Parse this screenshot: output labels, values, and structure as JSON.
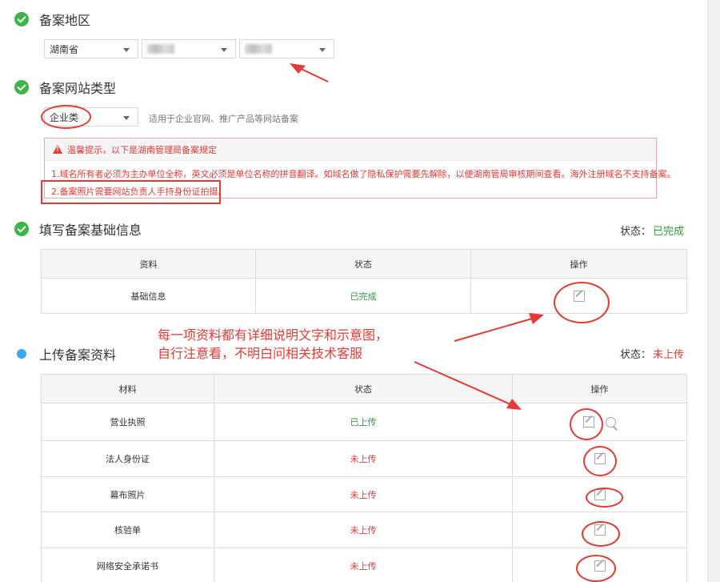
{
  "region": {
    "title": "备案地区",
    "province": "湖南省"
  },
  "site_type": {
    "title": "备案网站类型",
    "selected": "企业类",
    "hint": "适用于企业官网、推广产品等网站备案"
  },
  "tip": {
    "header": "温馨提示，以下是湖南管理局备案规定",
    "line1": "1.域名所有者必须为主办单位全称，英文必须是单位名称的拼音翻译。如域名做了隐私保护需要先解除，以便湖南管局审核期间查看。海外注册域名不支持备案。",
    "line2": "2.备案照片需要网站负责人手持身份证拍摄。"
  },
  "basic_info": {
    "title": "填写备案基础信息",
    "status_label": "状态：",
    "status_value": "已完成",
    "columns": [
      "资料",
      "状态",
      "操作"
    ],
    "rows": [
      {
        "name": "基础信息",
        "status": "已完成"
      }
    ]
  },
  "upload": {
    "title": "上传备案资料",
    "status_label": "状态：",
    "status_value": "未上传",
    "columns": [
      "材料",
      "状态",
      "操作"
    ],
    "rows": [
      {
        "name": "营业执照",
        "status": "已上传"
      },
      {
        "name": "法人身份证",
        "status": "未上传"
      },
      {
        "name": "幕布照片",
        "status": "未上传"
      },
      {
        "name": "核验单",
        "status": "未上传"
      },
      {
        "name": "网络安全承诺书",
        "status": "未上传"
      }
    ]
  },
  "annotation": {
    "line1": "每一项资料都有详细说明文字和示意图，",
    "line2": "自行注意看，不明白问相关技术客服"
  },
  "colors": {
    "success": "#2e9c3a",
    "danger": "#e53935",
    "check": "#3bb54a",
    "info_dot": "#3aa9f0"
  }
}
